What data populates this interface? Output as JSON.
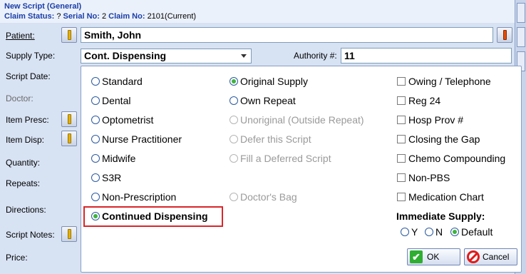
{
  "header": {
    "title": "New Script (General)",
    "claim_status_label": "Claim Status:",
    "claim_status_value": "?",
    "serial_label": "Serial No:",
    "serial_value": "2",
    "claim_no_label": "Claim No:",
    "claim_no_value": "2101(Current)"
  },
  "form": {
    "patient_label": "Patient:",
    "patient_value": "Smith, John",
    "supply_type_label": "Supply Type:",
    "supply_type_value": "Cont. Dispensing",
    "authority_label": "Authority #:",
    "authority_value": "11",
    "script_date_label": "Script Date:",
    "doctor_label": "Doctor:",
    "item_presc_label": "Item Presc:",
    "item_disp_label": "Item Disp:",
    "quantity_label": "Quantity:",
    "repeats_label": "Repeats:",
    "directions_label": "Directions:",
    "script_notes_label": "Script Notes:",
    "price_label": "Price:"
  },
  "prescriber_types": [
    {
      "label": "Standard",
      "selected": false
    },
    {
      "label": "Dental",
      "selected": false
    },
    {
      "label": "Optometrist",
      "selected": false
    },
    {
      "label": "Nurse Practitioner",
      "selected": false
    },
    {
      "label": "Midwife",
      "selected": false
    },
    {
      "label": "S3R",
      "selected": false
    },
    {
      "label": "Non-Prescription",
      "selected": false
    },
    {
      "label": "Continued Dispensing",
      "selected": true
    }
  ],
  "supply_options": [
    {
      "label": "Original Supply",
      "selected": true,
      "disabled": false
    },
    {
      "label": "Own Repeat",
      "selected": false,
      "disabled": false
    },
    {
      "label": "Unoriginal (Outside Repeat)",
      "selected": false,
      "disabled": true
    },
    {
      "label": "Defer this Script",
      "selected": false,
      "disabled": true
    },
    {
      "label": "Fill a Deferred Script",
      "selected": false,
      "disabled": true
    },
    {
      "label": "Doctor's Bag",
      "selected": false,
      "disabled": true
    }
  ],
  "checkboxes": [
    {
      "label": "Owing / Telephone",
      "checked": false
    },
    {
      "label": "Reg 24",
      "checked": false
    },
    {
      "label": "Hosp Prov #",
      "checked": false
    },
    {
      "label": "Closing the Gap",
      "checked": false
    },
    {
      "label": "Chemo Compounding",
      "checked": false
    },
    {
      "label": "Non-PBS",
      "checked": false
    },
    {
      "label": "Medication Chart",
      "checked": false
    }
  ],
  "immediate_supply": {
    "label": "Immediate Supply:",
    "options": [
      {
        "label": "Y",
        "selected": false
      },
      {
        "label": "N",
        "selected": false
      },
      {
        "label": "Default",
        "selected": true
      }
    ]
  },
  "buttons": {
    "ok_label": "OK",
    "cancel_label": "Cancel"
  },
  "colors": {
    "accent": "#1a3ea8",
    "highlight_border": "#d9262a",
    "radio_selected": "#3db43d"
  }
}
